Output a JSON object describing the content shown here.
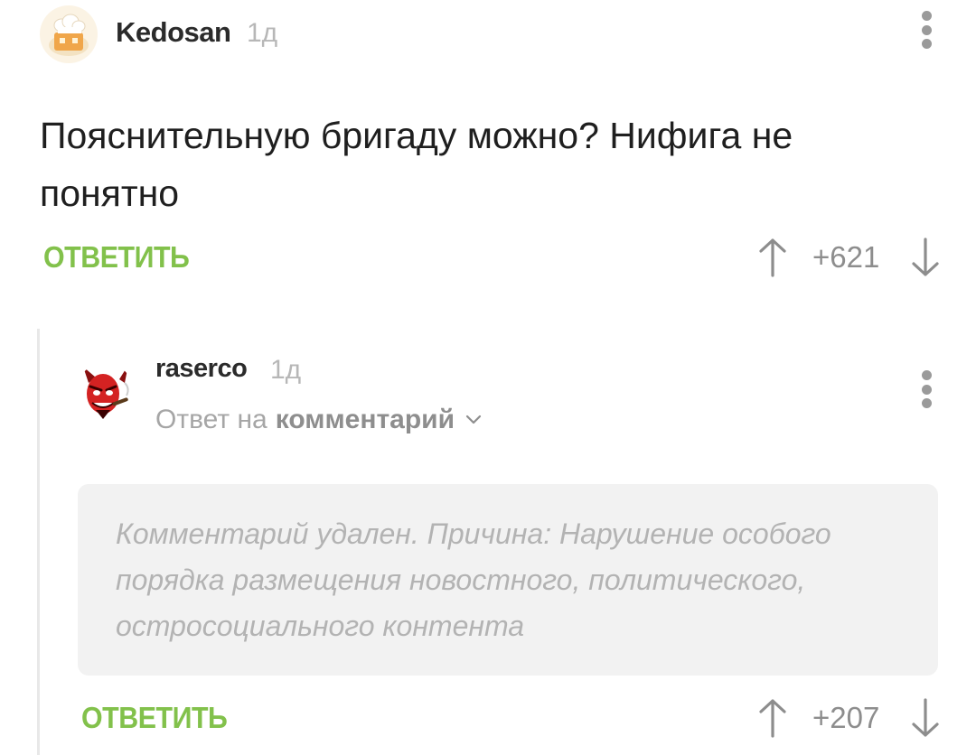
{
  "comments": [
    {
      "author": "Kedosan",
      "time": "1д",
      "text": "Пояснительную бригаду можно? Нифига не понятно",
      "reply_label": "ОТВЕТИТЬ",
      "score": "+621",
      "avatar_icon": "bakery-chef-icon",
      "more_icon": "kebab-menu-icon"
    },
    {
      "author": "raserco",
      "time": "1д",
      "reply_to_prefix": "Ответ на",
      "reply_to_link": "комментарий",
      "deleted_text": "Комментарий удален. Причина: Нарушение особого порядка размещения новостного, политического, остросоциального контента",
      "reply_label": "ОТВЕТИТЬ",
      "score": "+207",
      "avatar_icon": "red-devil-icon",
      "more_icon": "kebab-menu-icon"
    }
  ],
  "colors": {
    "reply_green": "#82c14b",
    "score_gray": "#8d8d8d",
    "deleted_bg": "#f2f2f2"
  }
}
